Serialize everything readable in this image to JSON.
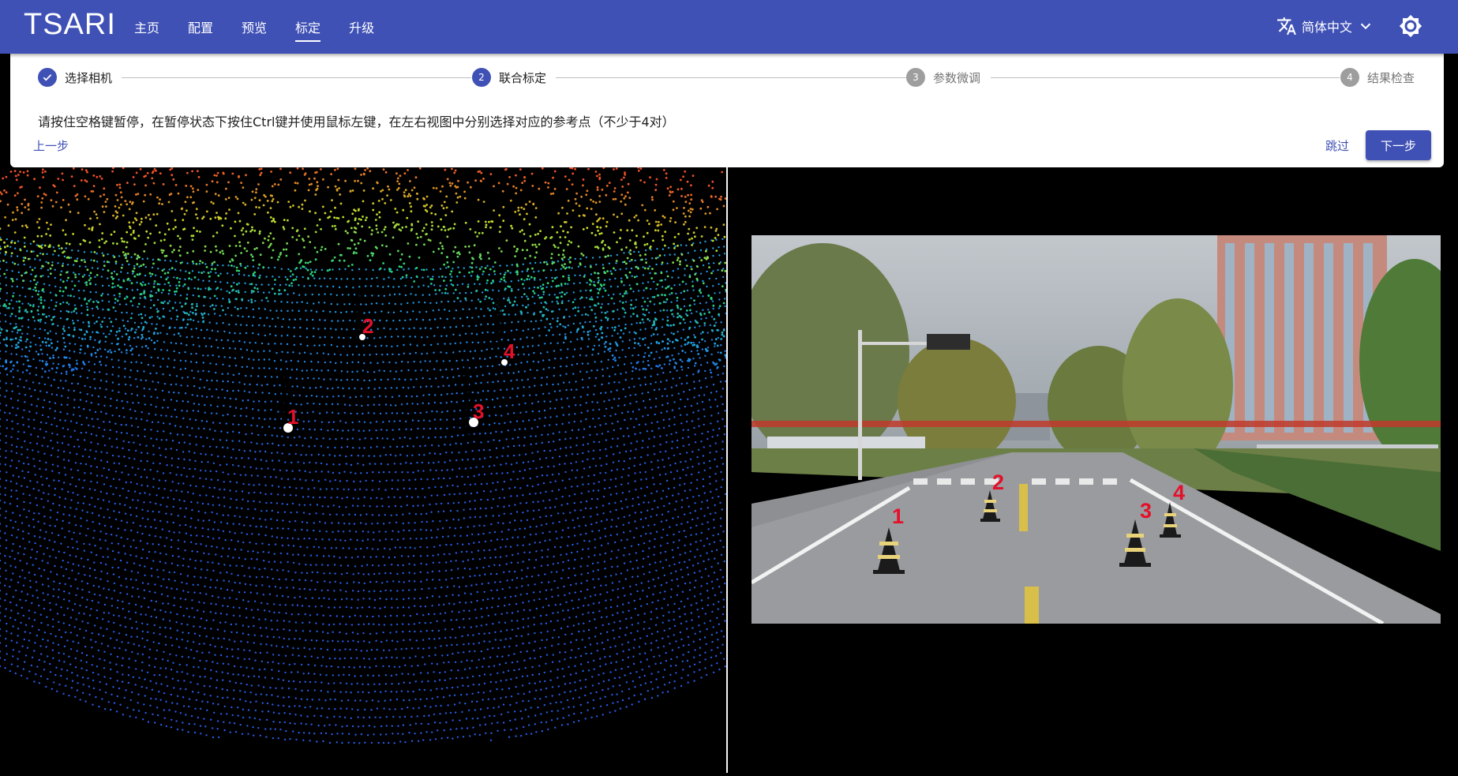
{
  "app": {
    "brand": "TSARI",
    "nav": [
      {
        "label": "主页",
        "active": false
      },
      {
        "label": "配置",
        "active": false
      },
      {
        "label": "预览",
        "active": false
      },
      {
        "label": "标定",
        "active": true
      },
      {
        "label": "升级",
        "active": false
      }
    ],
    "language": {
      "selected": "简体中文",
      "icon": "translate-icon"
    },
    "theme_icon": "brightness-icon"
  },
  "stepper": {
    "steps": [
      {
        "number": "",
        "label": "选择相机",
        "state": "done"
      },
      {
        "number": "2",
        "label": "联合标定",
        "state": "active"
      },
      {
        "number": "3",
        "label": "参数微调",
        "state": "pending"
      },
      {
        "number": "4",
        "label": "结果检查",
        "state": "pending"
      }
    ],
    "instruction": "请按住空格键暂停，在暂停状态下按住Ctrl键并使用鼠标左键，在左右视图中分别选择对应的参考点（不少于4对）",
    "back_label": "上一步",
    "skip_label": "跳过",
    "next_label": "下一步"
  },
  "lidar_view": {
    "markers": [
      "1",
      "2",
      "3",
      "4"
    ]
  },
  "camera_view": {
    "markers": [
      "1",
      "2",
      "3",
      "4"
    ]
  },
  "colors": {
    "primary": "#3f51b5",
    "marker": "#e4102a",
    "pending_step": "#9e9e9e"
  }
}
